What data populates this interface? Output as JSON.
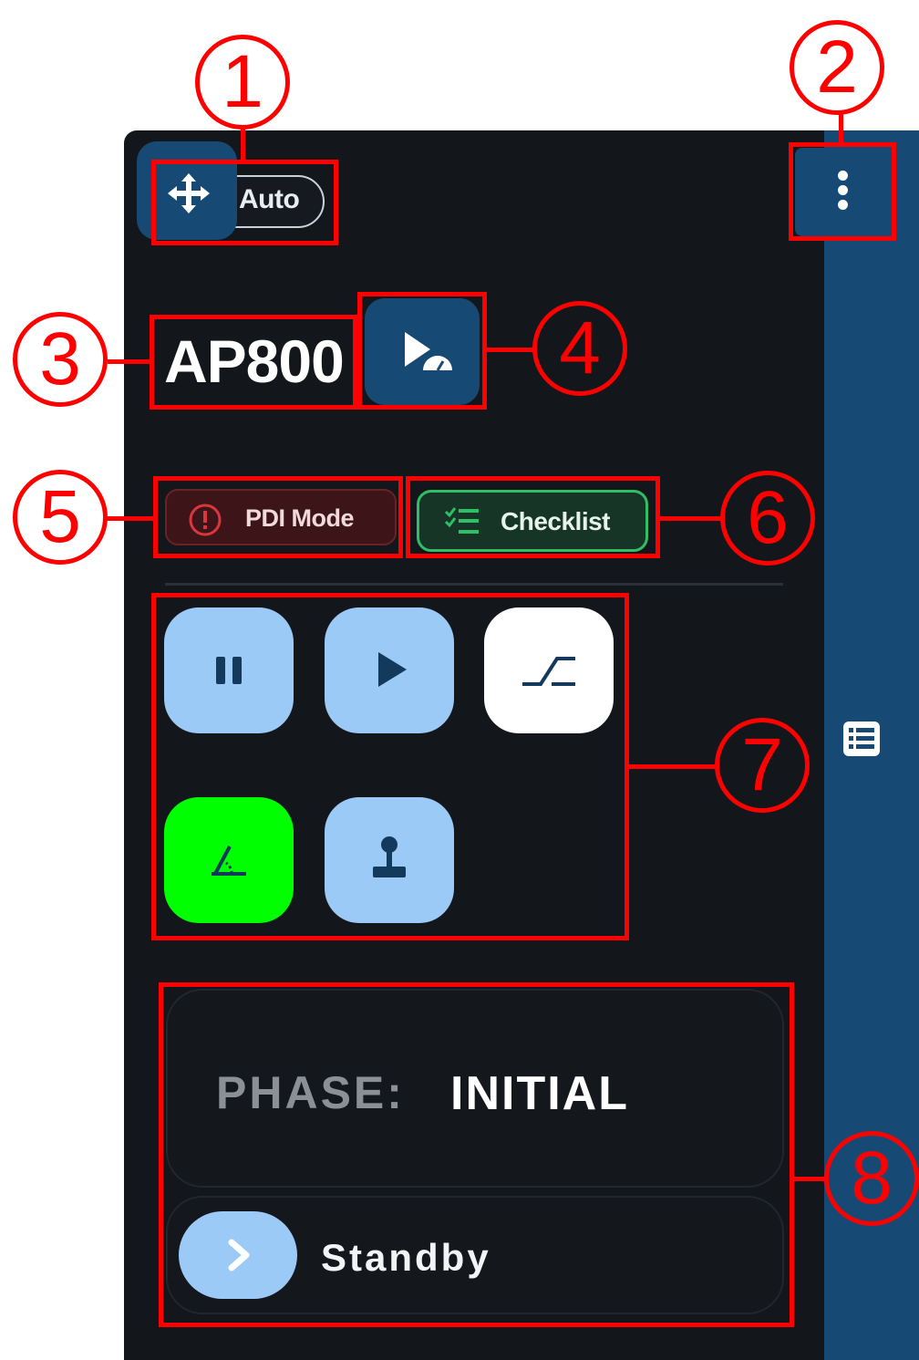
{
  "top_bar": {
    "mode_label": "Auto",
    "move_icon": "move-arrows-icon",
    "more_icon": "more-vertical-icon"
  },
  "title": {
    "text": "AP800",
    "action_icon": "play-speedometer-icon"
  },
  "chips": {
    "pdi": {
      "label": "PDI Mode",
      "icon": "alert-circle-icon",
      "color": "#3d1518"
    },
    "checklist": {
      "label": "Checklist",
      "icon": "checklist-icon",
      "color": "#2fbf65"
    }
  },
  "controls": [
    {
      "icon": "pause-icon",
      "color": "#9ccaf7"
    },
    {
      "icon": "play-icon",
      "color": "#9ccaf7"
    },
    {
      "icon": "ramp-icon",
      "color": "#ffffff"
    },
    {
      "icon": "angle-icon",
      "color": "#00ff00"
    },
    {
      "icon": "joystick-icon",
      "color": "#9ccaf7"
    }
  ],
  "phase": {
    "label": "PHASE:",
    "value": "INITIAL"
  },
  "standby": {
    "label": "Standby",
    "icon": "chevron-right-icon"
  },
  "side_strip": {
    "icon": "list-icon"
  },
  "annotations": [
    "1",
    "2",
    "3",
    "4",
    "5",
    "6",
    "7",
    "8"
  ],
  "colors": {
    "panel_bg": "#13161b",
    "accent_blue": "#164a74",
    "button_light_blue": "#9ccaf7",
    "annotation_red": "#ff0000"
  }
}
